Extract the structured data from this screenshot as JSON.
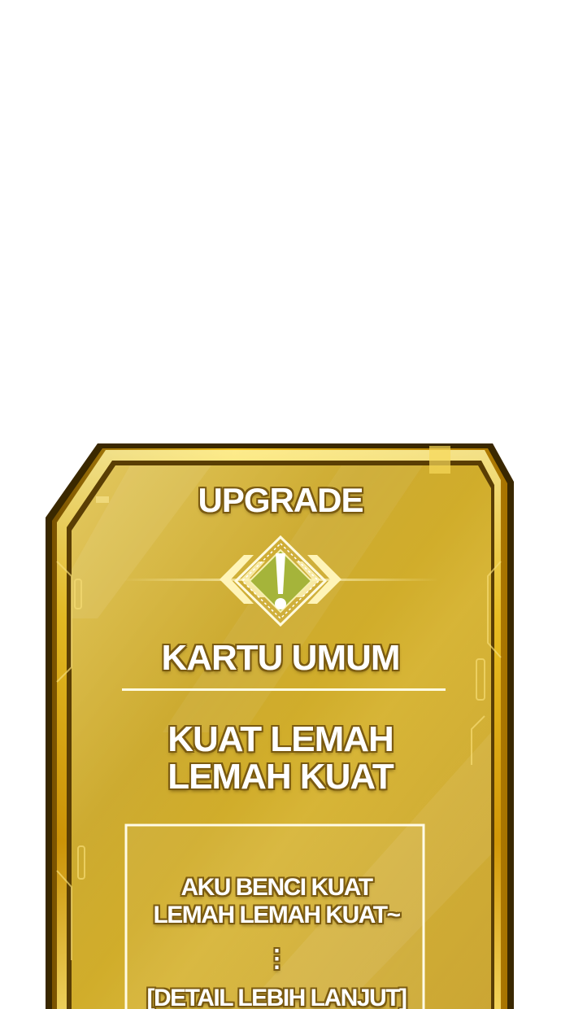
{
  "card": {
    "type_label": "UPGRADE",
    "category": "KARTU UMUM",
    "name_line1": "KUAT LEMAH",
    "name_line2": "LEMAH KUAT",
    "description_line1": "AKU BENCI KUAT",
    "description_line2": "LEMAH LEMAH KUAT~",
    "ellipsis": "⋮",
    "more_label": "[DETAIL LEBIH LANJUT]"
  },
  "icons": {
    "alert": "exclamation-diamond-icon"
  },
  "colors": {
    "gold_light": "#f6d96a",
    "gold_mid": "#d8ae22",
    "gold_dark": "#8a6410",
    "frame_dark": "#3a2800",
    "text_white": "#ffffff"
  }
}
